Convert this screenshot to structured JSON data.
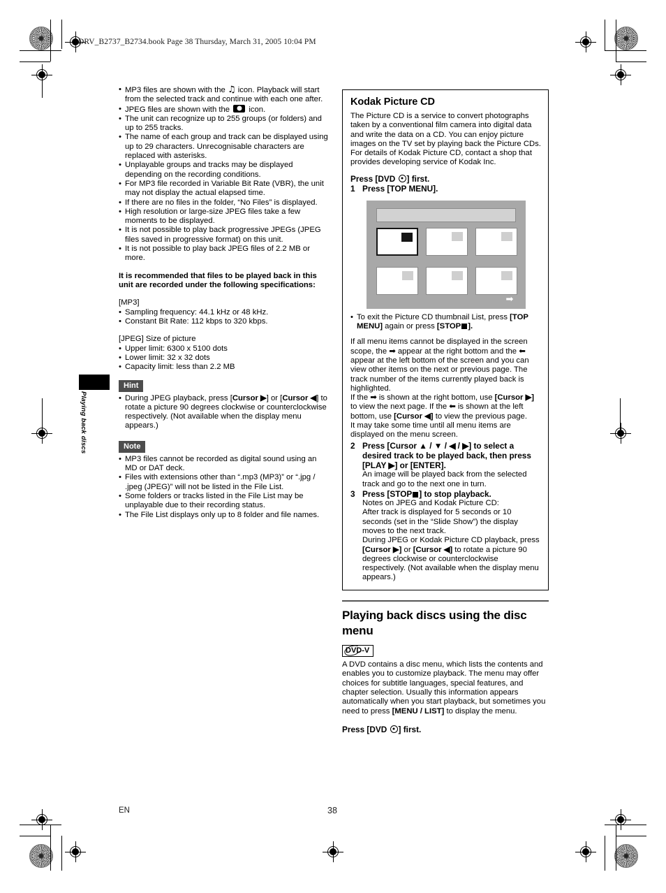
{
  "header": {
    "slug": "DRV_B2737_B2734.book  Page 38  Thursday, March 31, 2005  10:04 PM"
  },
  "side_tab": {
    "label": "Playing back discs"
  },
  "left_column": {
    "notes": [
      "MP3 files are shown with the ♫ icon. Playback will start from the selected track and continue with each one after.",
      "JPEG files are shown with the ■ icon.",
      "The unit can recognize up to 255 groups (or folders) and up to 255 tracks.",
      "The name of each group and track can be displayed using up to 29 characters. Unrecognisable characters are replaced with asterisks.",
      "Unplayable groups and tracks may be displayed depending on the recording conditions.",
      "For MP3 file recorded in Variable Bit Rate (VBR), the unit may not display the actual elapsed time.",
      "If there are no files in the folder, “No Files” is displayed.",
      "High resolution or large-size JPEG files take a few moments to be displayed.",
      "It is not possible to play back progressive JPEGs (JPEG files saved in progressive format) on this unit.",
      "It is not possible to play back JPEG files of 2.2 MB or more."
    ],
    "note_1_part_a": "MP3 files are shown with the",
    "note_1_part_b": "icon. Playback will start from the selected track and continue with each one after.",
    "note_2_part_a": "JPEG files are shown with the",
    "note_2_part_b": "icon.",
    "recommend_heading": "It is recommended that files to be played back in this unit are recorded under the following specifications:",
    "mp3_heading": "[MP3]",
    "mp3_specs": [
      "Sampling frequency: 44.1 kHz or 48 kHz.",
      "Constant Bit Rate: 112 kbps to 320 kbps."
    ],
    "jpeg_heading": "[JPEG] Size of picture",
    "jpeg_specs": [
      "Upper limit: 6300 x 5100 dots",
      "Lower limit: 32 x 32 dots",
      "Capacity limit: less than 2.2 MB"
    ],
    "hint_label": "Hint",
    "hint_text_a": "During JPEG playback, press [",
    "hint_cursor_right": "Cursor ▶",
    "hint_text_b": "] or [",
    "hint_cursor_left": "Cursor ◀",
    "hint_text_c": "] to rotate a picture 90 degrees clockwise or counterclockwise respectively. (Not available when the display menu appears.)",
    "note_label": "Note",
    "note_items": [
      "MP3 files cannot be recorded as digital sound using an MD or DAT deck.",
      "Files with extensions other than “.mp3 (MP3)” or “.jpg / .jpeg (JPEG)” will not be listed in the File List.",
      "Some folders or tracks listed in the File List may be unplayable due to their recording status.",
      "The File List displays only up to 8 folder and file names."
    ]
  },
  "kodak_box": {
    "title": "Kodak Picture CD",
    "paragraph_1": "The Picture CD is a service to convert photographs taken by a conventional film camera into digital data and write the data on a CD. You can enjoy picture images on the TV set by playing back the Picture CDs.",
    "paragraph_2": "For details of Kodak Picture CD, contact a shop that provides developing service of Kodak Inc.",
    "press_dvd_a": "Press [DVD",
    "press_dvd_b": "] first.",
    "step_1_num": "1",
    "step_1_text": "Press [TOP MENU].",
    "exit_note_a": "To exit the Picture CD thumbnail List, press",
    "exit_note_bold_1": "[TOP MENU]",
    "exit_note_mid": "again or press",
    "exit_note_bold_2": "[STOP",
    "exit_note_end": "].",
    "scope_para": "If all menu items cannot be displayed in the screen scope, the ➡ appear at the right bottom and the ⬅ appear at the left bottom of the screen and you can view other items on the next or previous page. The track number of the items currently played back is highlighted.",
    "page_para_a": "If the ➡ is shown at the right bottom, use",
    "page_para_cursor_r": "[Cursor ▶]",
    "page_para_b": "to view the next page. If the ⬅ is shown at the left bottom, use",
    "page_para_cursor_l": "[Cursor ◀]",
    "page_para_c": "to view the previous page.",
    "time_para": "It may take some time until all menu items are displayed on the menu screen.",
    "step_2_num": "2",
    "step_2_text": "Press [Cursor ▲ / ▼ / ◀ / ▶] to select a desired track to be played back, then press [PLAY ▶] or [ENTER].",
    "step_2_sub": "An image will be played back from the selected track and go to the next one in turn.",
    "step_3_num": "3",
    "step_3_text_a": "Press [STOP",
    "step_3_text_b": "] to stop playback.",
    "step_3_sub_1": "Notes on JPEG and Kodak Picture CD:",
    "step_3_sub_2": "After track is displayed for 5 seconds or 10 seconds (set in the “Slide Show”) the display moves to the next track.",
    "step_3_sub_3_a": "During JPEG or Kodak Picture CD playback, press",
    "step_3_cursor_r": "[Cursor ▶]",
    "step_3_or": "or",
    "step_3_cursor_l": "[Cursor ◀]",
    "step_3_sub_3_b": "to rotate a picture 90 degrees clockwise or counterclockwise respectively. (Not available when the display menu appears.)"
  },
  "screen_illustration": {
    "thumbnails": [
      {
        "selected": true
      },
      {
        "selected": false
      },
      {
        "selected": false
      },
      {
        "selected": false
      },
      {
        "selected": false
      },
      {
        "selected": false
      }
    ],
    "next_arrow": "➡",
    "colors": {
      "background": "#a8a8a8",
      "titlebar": "#d2d2d2",
      "thumbnail": "#ffffff",
      "selected_border": "#151515"
    }
  },
  "disc_menu_section": {
    "heading": "Playing back discs using the disc menu",
    "badge": "DVD-V",
    "paragraph_a": "A DVD contains a disc menu, which lists the contents and enables you to customize playback. The menu may offer choices for subtitle languages, special features, and chapter selection. Usually this information appears automatically when you start playback, but sometimes you need to press",
    "paragraph_bold": "[MENU / LIST]",
    "paragraph_b": "to display the menu.",
    "press_dvd_a": "Press [DVD",
    "press_dvd_b": "] first."
  },
  "footer": {
    "language": "EN",
    "page_number": "38"
  }
}
